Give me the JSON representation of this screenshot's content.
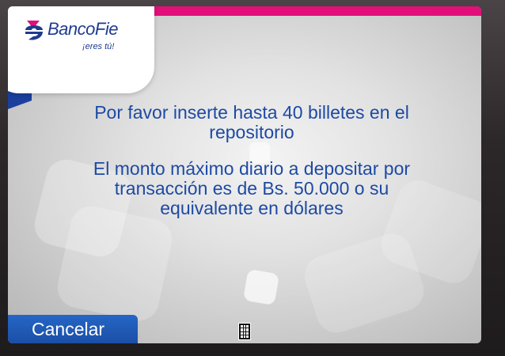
{
  "brand": {
    "name_part1": "Banco",
    "name_part2": "Fie",
    "tagline": "¡eres tú!",
    "colors": {
      "blue": "#1f3b8f",
      "pink": "#e20f7a"
    }
  },
  "message": {
    "line1": "Por favor inserte hasta 40 billetes en el repositorio",
    "line2": "El monto máximo diario a depositar por transacción es de Bs. 50.000 o su equivalente en dólares"
  },
  "actions": {
    "cancel_label": "Cancelar"
  },
  "icons": {
    "keypad": "keypad-icon",
    "logo": "bancofie-logo-mark"
  }
}
